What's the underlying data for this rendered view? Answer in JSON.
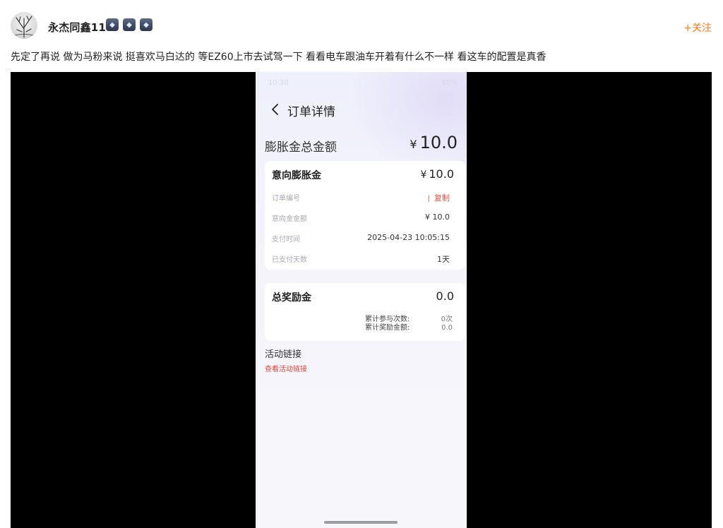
{
  "post": {
    "username": "永杰同鑫11",
    "follow_label": "+关注",
    "text": "先定了再说 做为马粉来说 挺喜欢马白达的 等EZ60上市去试驾一下 看看电车跟油车开着有什么不一样 看这车的配置是真香",
    "badge_icons": [
      "level-badge-icon",
      "level-badge-icon",
      "level-badge-icon"
    ]
  },
  "phone": {
    "status_time": "10:30",
    "status_right": "65%",
    "nav_title": "订单详情",
    "total": {
      "label": "膨胀金总金额",
      "currency": "¥",
      "amount": "10.0"
    },
    "intent_card": {
      "title": "意向膨胀金",
      "currency": "¥",
      "amount": "10.0",
      "rows": [
        {
          "label": "订单编号",
          "value": "",
          "action": "复制"
        },
        {
          "label": "意向金金额",
          "value": "¥ 10.0"
        },
        {
          "label": "支付时间",
          "value": "2025-04-23 10:05:15"
        },
        {
          "label": "已支付天数",
          "value": "1天"
        }
      ]
    },
    "reward_card": {
      "title": "总奖励金",
      "amount": "0.0",
      "stats": [
        {
          "label": "累计参与次数:",
          "value": "0次"
        },
        {
          "label": "累计奖励金额:",
          "value": "0.0"
        }
      ]
    },
    "activity": {
      "title": "活动链接",
      "link": "查看活动链接"
    }
  },
  "colors": {
    "follow": "#ff7a21",
    "link_red": "#e0523e",
    "media_bg": "#000000"
  }
}
